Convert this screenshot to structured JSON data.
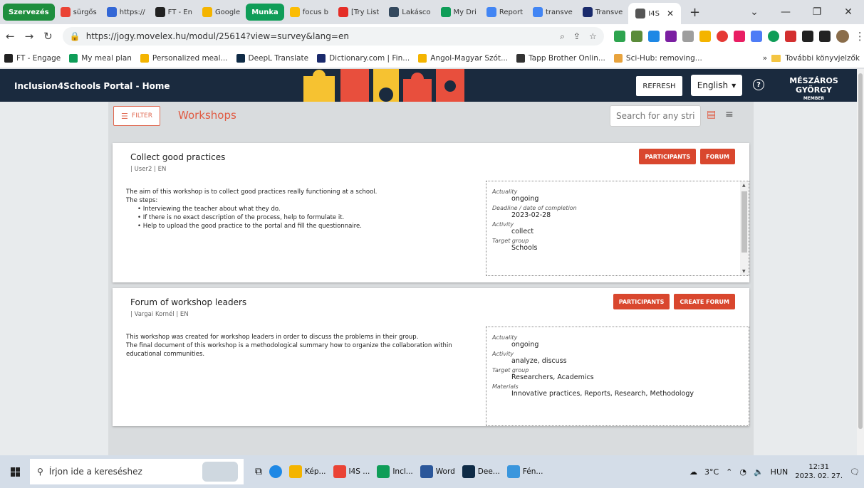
{
  "browser": {
    "tabs": [
      {
        "label": "Szervezés",
        "type": "group",
        "color": "#1e8e3e"
      },
      {
        "label": "sürgős",
        "color": "#ea4335"
      },
      {
        "label": "https://",
        "color": "#3367d6"
      },
      {
        "label": "FT - En",
        "color": "#222222"
      },
      {
        "label": "Google",
        "color": "#f4b400"
      },
      {
        "label": "Munka",
        "type": "group",
        "color": "#0f9d58"
      },
      {
        "label": "focus b",
        "color": "#fbbc04"
      },
      {
        "label": "[Try List",
        "color": "#e52d27"
      },
      {
        "label": "Lakásco",
        "color": "#34495e"
      },
      {
        "label": "My Dri",
        "color": "#0f9d58"
      },
      {
        "label": "Report",
        "color": "#4285f4"
      },
      {
        "label": "transve",
        "color": "#4285f4"
      },
      {
        "label": "Transve",
        "color": "#1a2a6c"
      },
      {
        "label": "I4S",
        "active": true,
        "color": "#555555"
      }
    ],
    "url": "https://jogy.movelex.hu/modul/25614?view=survey&lang=en",
    "bookmarks": [
      {
        "label": "FT - Engage",
        "color": "#222222"
      },
      {
        "label": "My meal plan",
        "color": "#0f9d58"
      },
      {
        "label": "Personalized meal...",
        "color": "#f4b400"
      },
      {
        "label": "DeepL Translate",
        "color": "#0f2b46"
      },
      {
        "label": "Dictionary.com | Fin...",
        "color": "#1a2a6c"
      },
      {
        "label": "Angol-Magyar Szót...",
        "color": "#f4b400"
      },
      {
        "label": "Tapp Brother Onlin...",
        "color": "#333333"
      },
      {
        "label": "Sci-Hub: removing...",
        "color": "#e8a33d"
      }
    ],
    "bookmarks_more": "»",
    "other_bookmarks": "További könyvjelzők"
  },
  "app": {
    "title": "Inclusion4Schools Portal - Home",
    "refresh_label": "REFRESH",
    "language": "English",
    "user_name": "MÉSZÁROS GYÖRGY",
    "user_role": "MEMBER",
    "filter_label": "FILTER",
    "section_title": "Workshops",
    "search_placeholder": "Search for any stri...",
    "accent": "#d9472e"
  },
  "workshops": [
    {
      "title": "Collect good practices",
      "meta": "| User2 | EN",
      "buttons": [
        "PARTICIPANTS",
        "FORUM"
      ],
      "desc_lines": [
        "The aim of this workshop is to collect good practices really functioning at a school.",
        "The steps:"
      ],
      "desc_bullets": [
        "Interviewing the teacher about what they do.",
        "If there is no exact description of the process, help to formulate it.",
        "Help to upload the good practice to the portal and fill the questionnaire."
      ],
      "props": [
        {
          "label": "Actuality",
          "value": "ongoing"
        },
        {
          "label": "Deadline / date of completion",
          "value": "2023-02-28"
        },
        {
          "label": "Activity",
          "value": "collect"
        },
        {
          "label": "Target group",
          "value": "Schools"
        }
      ]
    },
    {
      "title": "Forum of workshop leaders",
      "meta": "| Vargai Kornél | EN",
      "buttons": [
        "PARTICIPANTS",
        "CREATE FORUM"
      ],
      "desc_lines": [
        "This workshop was created for workshop leaders in order to discuss the problems in their group.",
        "The final document of this workshop is a methodological summary how to organize the collaboration within educational communities."
      ],
      "props": [
        {
          "label": "Actuality",
          "value": "ongoing"
        },
        {
          "label": "Activity",
          "value": "analyze, discuss"
        },
        {
          "label": "Target group",
          "value": "Researchers, Academics"
        },
        {
          "label": "Materials",
          "value": "Innovative practices, Reports, Research, Methodology"
        }
      ]
    }
  ],
  "taskbar": {
    "search_placeholder": "Írjon ide a kereséshez",
    "apps": [
      {
        "label": "Kép...",
        "color": "#f4b400"
      },
      {
        "label": "I4S ...",
        "color": "#ea4335"
      },
      {
        "label": "Incl...",
        "color": "#0f9d58"
      },
      {
        "label": "Word",
        "color": "#2b579a"
      },
      {
        "label": "Dee...",
        "color": "#0f2b46"
      },
      {
        "label": "Fén...",
        "color": "#3a96dd"
      }
    ],
    "weather": "3°C",
    "language": "HUN",
    "time": "12:31",
    "date": "2023. 02. 27."
  }
}
